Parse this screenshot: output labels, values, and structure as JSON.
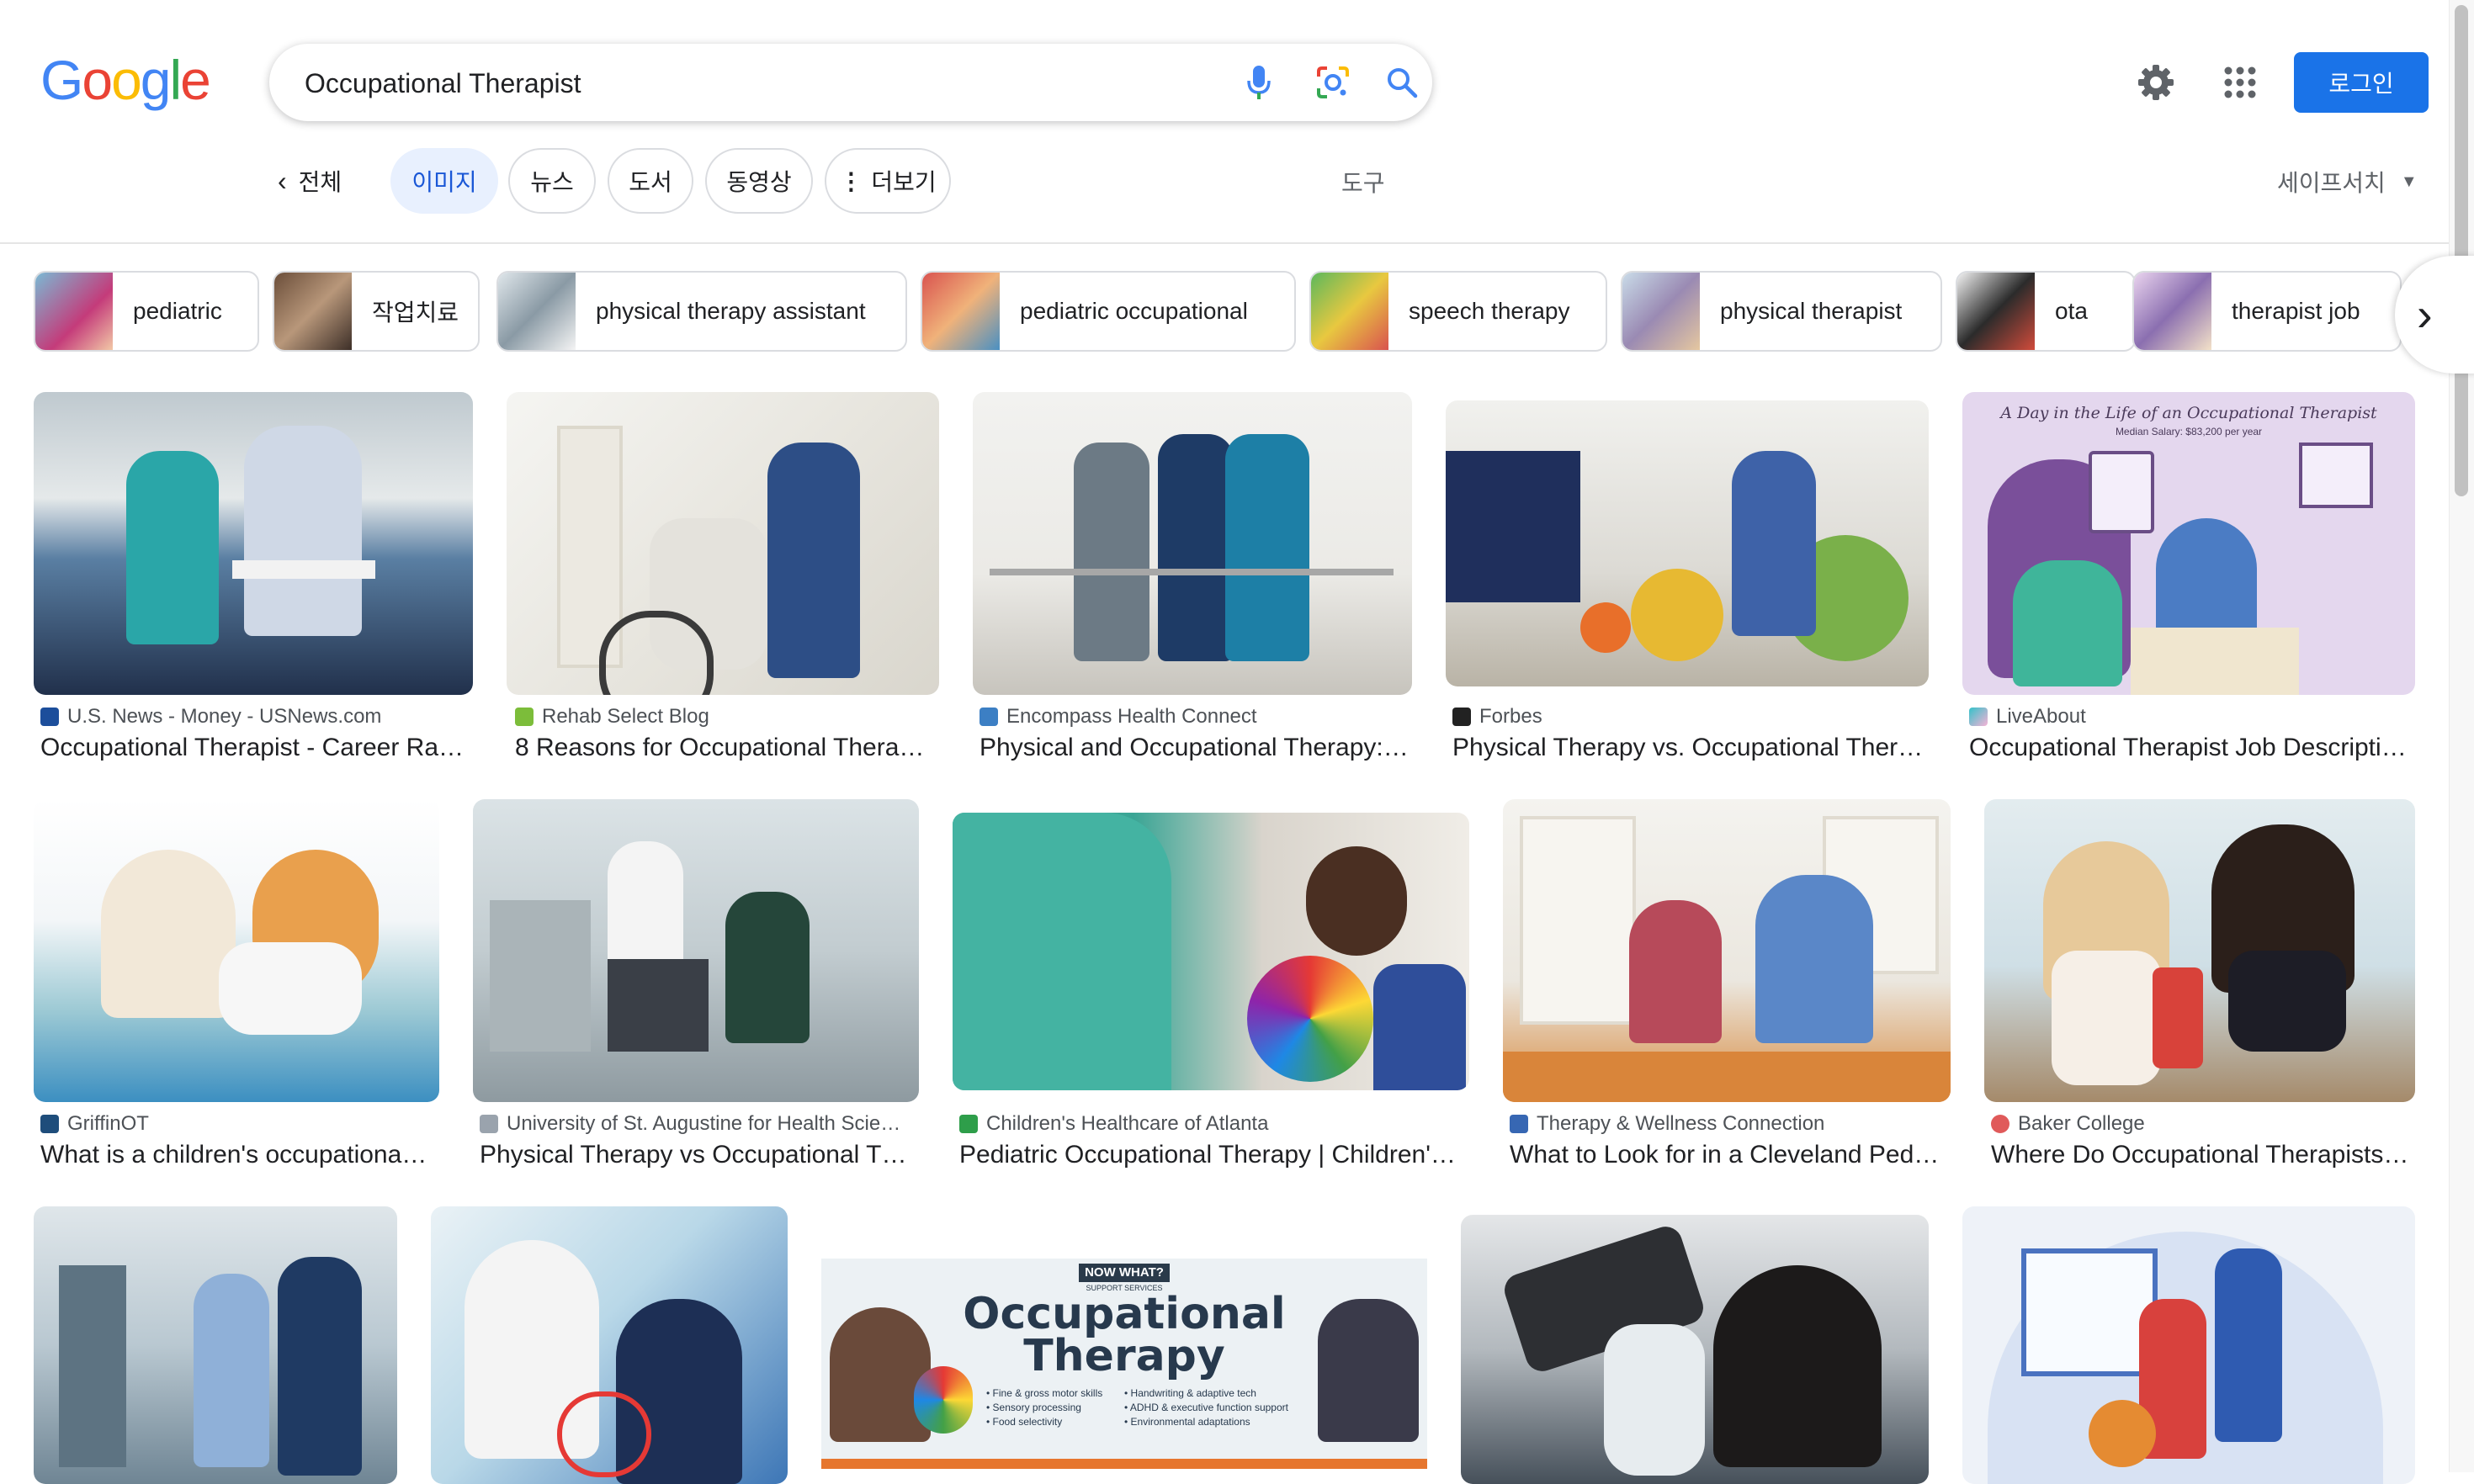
{
  "header": {
    "logo_text": "Google",
    "search_query": "Occupational Therapist",
    "icons": [
      "mic-icon",
      "lens-icon",
      "search-icon",
      "gear-icon",
      "apps-grid-icon"
    ],
    "login_label": "로그인",
    "accent": "#1a73e8"
  },
  "tabs": {
    "back_label": "전체",
    "items": [
      {
        "label": "이미지",
        "active": true
      },
      {
        "label": "뉴스"
      },
      {
        "label": "도서"
      },
      {
        "label": "동영상"
      },
      {
        "label": "더보기"
      }
    ],
    "tools_label": "도구",
    "safesearch_label": "세이프서치"
  },
  "chips": [
    "pediatric",
    "작업치료",
    "physical therapy assistant",
    "pediatric occupational",
    "speech therapy",
    "physical therapist",
    "ota",
    "therapist job"
  ],
  "results": [
    {
      "source": "U.S. News - Money - USNews.com",
      "title": "Occupational Therapist - Career Ranki…"
    },
    {
      "source": "Rehab Select Blog",
      "title": "8 Reasons for Occupational Therapy …"
    },
    {
      "source": "Encompass Health Connect",
      "title": "Physical and Occupational Therapy: …"
    },
    {
      "source": "Forbes",
      "title": "Physical Therapy vs. Occupational Therap…"
    },
    {
      "source": "LiveAbout",
      "title": "Occupational Therapist Job Descriptio…",
      "image_text": {
        "heading": "A Day in the Life of an Occupational Therapist",
        "salary": "Median Salary: $83,200 per year"
      }
    },
    {
      "source": "GriffinOT",
      "title": "What is a children's occupational t…"
    },
    {
      "source": "University of St. Augustine for Health Scie…",
      "title": "Physical Therapy vs Occupational Ther…"
    },
    {
      "source": "Children's Healthcare of Atlanta",
      "title": "Pediatric Occupational Therapy | Children's H…"
    },
    {
      "source": "Therapy & Wellness Connection",
      "title": "What to Look for in a Cleveland Pediat…"
    },
    {
      "source": "Baker College",
      "title": "Where Do Occupational Therapists W…"
    }
  ],
  "banner": {
    "tag": "NOW WHAT?",
    "tag_sub": "SUPPORT SERVICES",
    "line1": "Occupational",
    "line2": "Therapy",
    "bullets_left": [
      "Fine & gross motor skills",
      "Sensory processing",
      "Food selectivity"
    ],
    "bullets_right": [
      "Handwriting & adaptive tech",
      "ADHD & executive function support",
      "Environmental adaptations"
    ]
  }
}
